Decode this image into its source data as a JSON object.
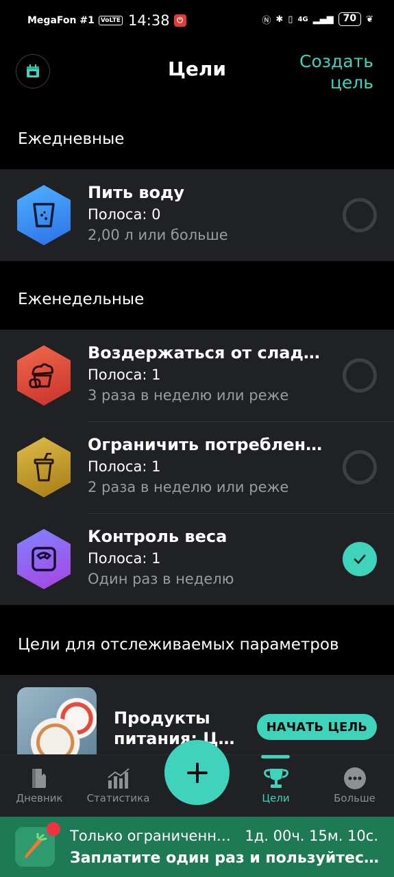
{
  "status_bar": {
    "carrier": "MegaFon #1",
    "volte": "VoLTE",
    "time": "14:38",
    "network": "4G",
    "battery": "70"
  },
  "header": {
    "title": "Цели",
    "create_label": "Создать цель"
  },
  "daily": {
    "title": "Ежедневные",
    "goals": [
      {
        "name": "Пить воду",
        "streak": "Полоса: 0",
        "rule": "2,00 л или больше",
        "done": false,
        "color": "#3d8cf5"
      }
    ]
  },
  "weekly": {
    "title": "Еженедельные",
    "goals": [
      {
        "name": "Воздержаться от сладк…",
        "streak": "Полоса: 1",
        "rule": "3 раза в неделю или реже",
        "done": false,
        "color": "#e0483b"
      },
      {
        "name": "Ограничить потреблени…",
        "streak": "Полоса: 1",
        "rule": "2 раза в неделю или реже",
        "done": false,
        "color": "#c99a22"
      },
      {
        "name": "Контроль веса",
        "streak": "Полоса: 1",
        "rule": "Один раз в неделю",
        "done": true,
        "color": "#8a55e8"
      }
    ]
  },
  "tracked": {
    "title": "Цели для отслеживаемых параметров",
    "item_title": "Продукты питания: Ц…",
    "start_label": "НАЧАТЬ ЦЕЛЬ"
  },
  "nav": {
    "items": [
      "Дневник",
      "Статистика",
      "Цели",
      "Больше"
    ],
    "active": "Цели"
  },
  "promo": {
    "line1": "Только ограниченн…",
    "timer": "1д. 00ч. 15м. 10с.",
    "line2": "Заплатите один раз и пользуйтес…"
  },
  "colors": {
    "accent": "#3fd3bc",
    "card_bg": "#1f2124",
    "promo_bg": "#1d7a54"
  }
}
